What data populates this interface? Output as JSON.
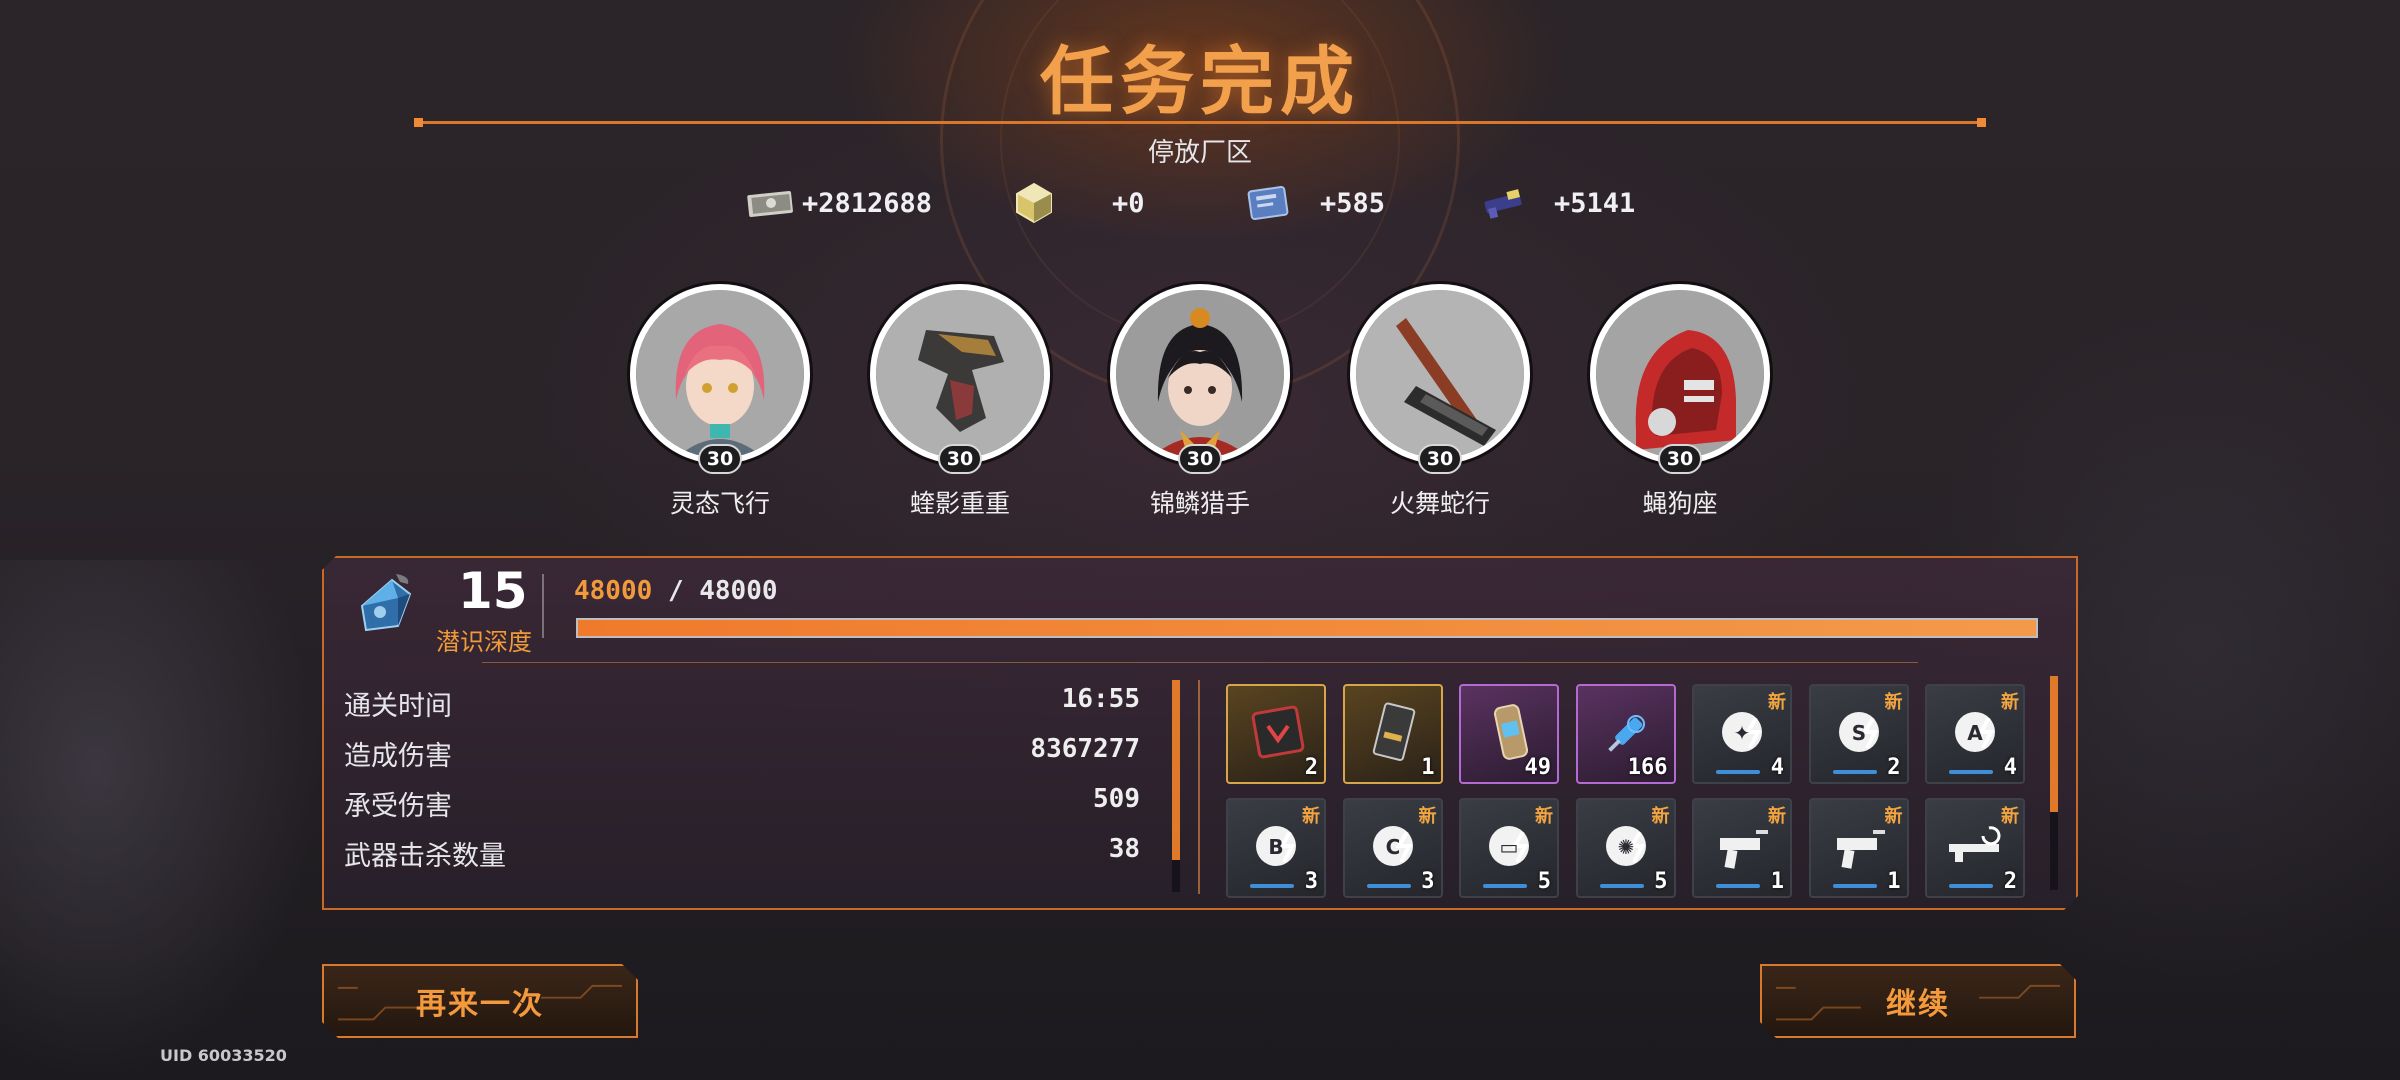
{
  "header": {
    "title": "任务完成",
    "stage": "停放厂区"
  },
  "rewards": [
    {
      "icon": "cash-icon",
      "value": "+2812688"
    },
    {
      "icon": "crystal-icon",
      "value": "+0"
    },
    {
      "icon": "book-icon",
      "value": "+585"
    },
    {
      "icon": "weapon-module-icon",
      "value": "+5141"
    }
  ],
  "characters": [
    {
      "name": "灵态飞行",
      "level": "30"
    },
    {
      "name": "蝰影重重",
      "level": "30"
    },
    {
      "name": "锦鳞猎手",
      "level": "30"
    },
    {
      "name": "火舞蛇行",
      "level": "30"
    },
    {
      "name": "蝇狗座",
      "level": "30"
    }
  ],
  "depth": {
    "level": "15",
    "label": "潜识深度",
    "xp_current": "48000",
    "xp_separator": "/",
    "xp_max": "48000",
    "progress": 1.0
  },
  "stats": [
    {
      "label": "通关时间",
      "value": "16:55"
    },
    {
      "label": "造成伤害",
      "value": "8367277"
    },
    {
      "label": "承受伤害",
      "value": "509"
    },
    {
      "label": "武器击杀数量",
      "value": "38"
    }
  ],
  "items": [
    {
      "icon": "chip-icon",
      "count": "2",
      "rarity": "gold",
      "new": ""
    },
    {
      "icon": "card-icon",
      "count": "1",
      "rarity": "gold",
      "new": ""
    },
    {
      "icon": "canister-icon",
      "count": "49",
      "rarity": "purple",
      "new": ""
    },
    {
      "icon": "syringe-icon",
      "count": "166",
      "rarity": "purple",
      "new": ""
    },
    {
      "icon": "blast-module-icon",
      "count": "4",
      "rarity": "gray",
      "new": "新"
    },
    {
      "icon": "s-module-icon",
      "count": "2",
      "rarity": "gray",
      "new": "新"
    },
    {
      "icon": "a-module-icon",
      "count": "4",
      "rarity": "gray",
      "new": "新"
    },
    {
      "icon": "b-module-icon",
      "count": "3",
      "rarity": "gray",
      "new": "新"
    },
    {
      "icon": "c-module-icon",
      "count": "3",
      "rarity": "gray",
      "new": "新"
    },
    {
      "icon": "monitor-module-icon",
      "count": "5",
      "rarity": "gray",
      "new": "新"
    },
    {
      "icon": "burst-module-icon",
      "count": "5",
      "rarity": "gray",
      "new": "新"
    },
    {
      "icon": "pistol-icon",
      "count": "1",
      "rarity": "gray",
      "new": "新"
    },
    {
      "icon": "smg-icon",
      "count": "1",
      "rarity": "gray",
      "new": "新"
    },
    {
      "icon": "rifle-icon",
      "count": "2",
      "rarity": "gray",
      "new": "新"
    }
  ],
  "buttons": {
    "retry": "再来一次",
    "continue": "继续"
  },
  "footer": {
    "uid": "UID 60033520"
  },
  "colors": {
    "accent": "#f2a04c",
    "panel_border": "#c86a26",
    "xp_fill": "#f07a2c",
    "rarity_gold": "#d8a64a",
    "rarity_purple": "#b46ad0"
  }
}
